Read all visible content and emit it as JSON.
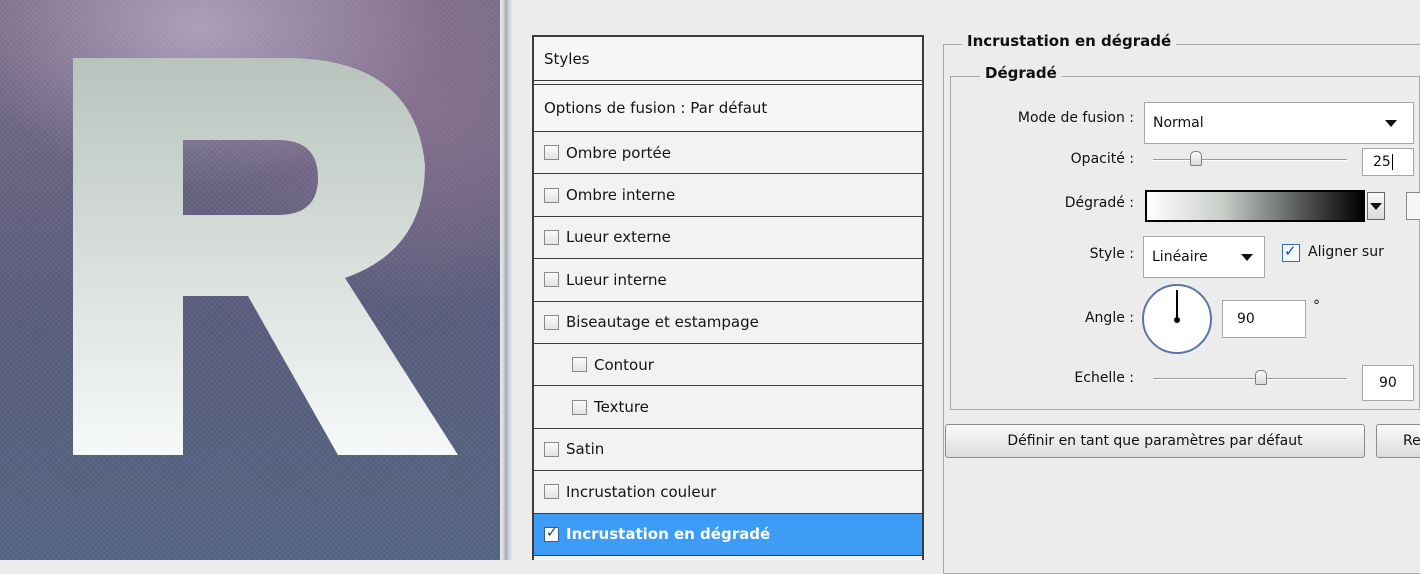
{
  "canvas": {
    "preview_letter": "R"
  },
  "styles_list": {
    "header": "Styles",
    "blend_options": "Options de fusion : Par défaut",
    "items": [
      {
        "label": "Ombre portée",
        "checked": false,
        "indent": false
      },
      {
        "label": "Ombre interne",
        "checked": false,
        "indent": false
      },
      {
        "label": "Lueur externe",
        "checked": false,
        "indent": false
      },
      {
        "label": "Lueur interne",
        "checked": false,
        "indent": false
      },
      {
        "label": "Biseautage et estampage",
        "checked": false,
        "indent": false
      },
      {
        "label": "Contour",
        "checked": false,
        "indent": true
      },
      {
        "label": "Texture",
        "checked": false,
        "indent": true
      },
      {
        "label": "Satin",
        "checked": false,
        "indent": false
      },
      {
        "label": "Incrustation couleur",
        "checked": false,
        "indent": false
      },
      {
        "label": "Incrustation en dégradé",
        "checked": true,
        "indent": false,
        "selected": true
      }
    ]
  },
  "settings": {
    "group_title": "Incrustation en dégradé",
    "subgroup_title": "Dégradé",
    "blend_mode_label": "Mode de fusion :",
    "blend_mode_value": "Normal",
    "opacity_label": "Opacité :",
    "opacity_value": "25",
    "gradient_label": "Dégradé :",
    "style_label": "Style :",
    "style_value": "Linéaire",
    "align_label": "Aligner sur",
    "align_checked": true,
    "angle_label": "Angle :",
    "angle_value": "90",
    "angle_unit": "°",
    "scale_label": "Echelle :",
    "scale_value": "90",
    "default_button": "Définir en tant que paramètres par défaut",
    "reset_button": "Re"
  },
  "colors": {
    "selection": "#3d9cf5",
    "gradient_start": "#ffffff",
    "gradient_end": "#000000"
  }
}
